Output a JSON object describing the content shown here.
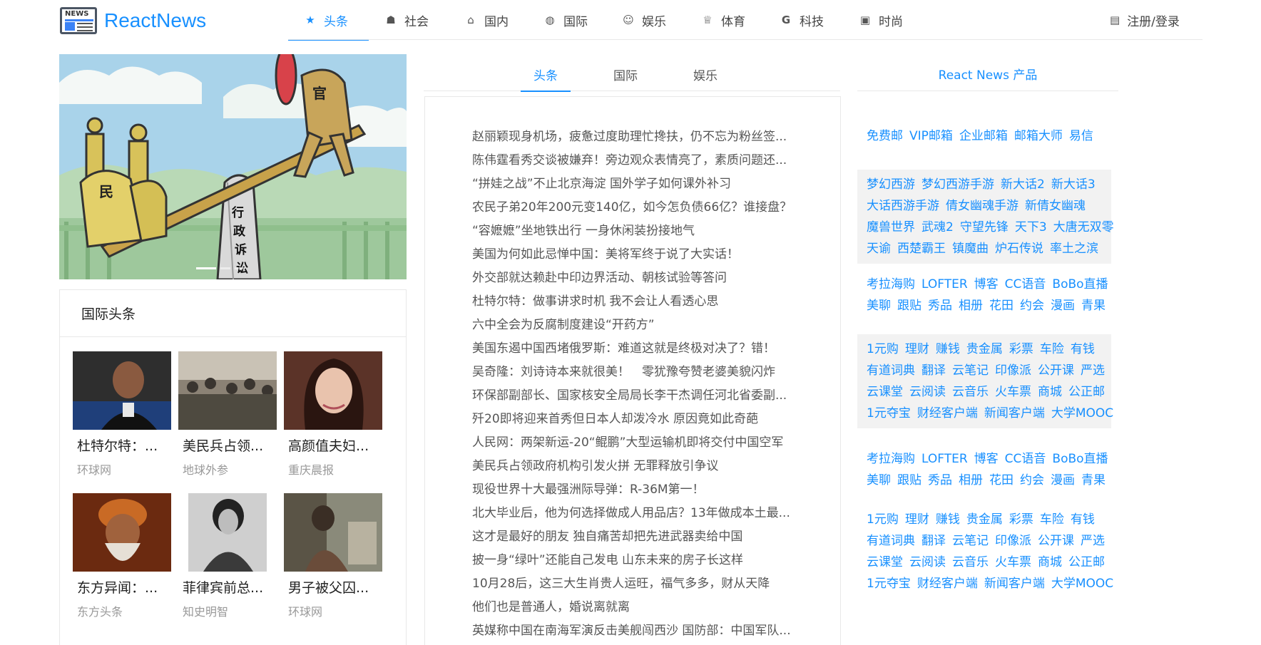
{
  "brand": {
    "logo_text": "NEWS",
    "title": "ReactNews"
  },
  "nav": {
    "items": [
      {
        "icon": "star-icon",
        "glyph": "★",
        "label": "头条",
        "active": true
      },
      {
        "icon": "user-icon",
        "glyph": "☗",
        "label": "社会"
      },
      {
        "icon": "lock-icon",
        "glyph": "⌂",
        "label": "国内"
      },
      {
        "icon": "globe-icon",
        "glyph": "◍",
        "label": "国际"
      },
      {
        "icon": "smile-icon",
        "glyph": "☺",
        "label": "娱乐"
      },
      {
        "icon": "trophy-icon",
        "glyph": "♕",
        "label": "体育"
      },
      {
        "icon": "google-icon",
        "glyph": "G",
        "label": "科技"
      },
      {
        "icon": "gift-icon",
        "glyph": "▣",
        "label": "时尚"
      }
    ],
    "account_icon": "idcard-icon",
    "account_glyph": "▤",
    "account_label": "注册/登录"
  },
  "carousel": {
    "slide_text_left": "民",
    "slide_text_right": "官",
    "slide_text_pillar": [
      "行",
      "政",
      "诉",
      "讼"
    ],
    "slide_count": 3,
    "active_slide": 1
  },
  "intl": {
    "heading": "国际头条",
    "items": [
      {
        "title": "杜特尔特：...",
        "source": "环球网"
      },
      {
        "title": "美民兵占领...",
        "source": "地球外参"
      },
      {
        "title": "高颜值夫妇...",
        "source": "重庆晨报"
      },
      {
        "title": "东方异闻：...",
        "source": "东方头条"
      },
      {
        "title": "菲律宾前总...",
        "source": "知史明智"
      },
      {
        "title": "男子被父囚...",
        "source": "环球网"
      }
    ]
  },
  "mid": {
    "tabs": [
      {
        "label": "头条",
        "active": true
      },
      {
        "label": "国际"
      },
      {
        "label": "娱乐"
      }
    ],
    "headlines": [
      "赵丽颖现身机场，疲惫过度助理忙搀扶，仍不忘为粉丝签...",
      "陈伟霆看秀交谈被嫌弃！旁边观众表情亮了，素质问题还...",
      "“拼娃之战”不止北京海淀 国外学子如何课外补习",
      "农民子弟20年200元变140亿，如今怎负债66亿？谁接盘？",
      "“容嬷嬷”坐地铁出行 一身休闲装扮接地气",
      "美国为何如此忌惮中国：美将军终于说了大实话！",
      "外交部就达赖赴中印边界活动、朝核试验等答问",
      "杜特尔特：做事讲求时机 我不会让人看透心思",
      "六中全会为反腐制度建设“开药方”",
      "美国东遏中国西堵俄罗斯：难道这就是终极对决了？错！",
      "吴奇隆：刘诗诗本来就很美！　零犹豫夸赞老婆美貌闪炸",
      "环保部副部长、国家核安全局局长李干杰调任河北省委副...",
      "歼20即将迎来首秀但日本人却泼冷水 原因竟如此奇葩",
      "人民网：两架新运-20“鲲鹏”大型运输机即将交付中国空军",
      "美民兵占领政府机构引发火拼 无罪释放引争议",
      "现役世界十大最强洲际导弹：R-36M第一！",
      "北大毕业后，他为何选择做成人用品店？13年做成本土最...",
      "这才是最好的朋友 独自痛苦却把先进武器卖给中国",
      "披一身“绿叶”还能自己发电 山东未来的房子长这样",
      "10月28后，这三大生肖贵人运旺，福气多多，财从天降",
      "他们也是普通人，婚说离就离",
      "英媒称中国在南海军演反击美舰闯西沙 国防部：中国军队..."
    ]
  },
  "products": {
    "heading": "React News 产品",
    "blocks": [
      {
        "shade": false,
        "lines": [
          [
            "免费邮",
            "VIP邮箱",
            "企业邮箱",
            "邮箱大师",
            "易信"
          ]
        ]
      },
      {
        "shade": true,
        "lines": [
          [
            "梦幻西游",
            "梦幻西游手游",
            "新大话2",
            "新大话3"
          ],
          [
            "大话西游手游",
            "倩女幽魂手游",
            "新倩女幽魂"
          ],
          [
            "魔兽世界",
            "武魂2",
            "守望先锋",
            "天下3",
            "大唐无双零"
          ],
          [
            "天谕",
            "西楚霸王",
            "镇魔曲",
            "炉石传说",
            "率土之滨"
          ]
        ]
      },
      {
        "shade": false,
        "lines": [
          [
            "考拉海购",
            "LOFTER",
            "博客",
            "CC语音",
            "BoBo直播"
          ],
          [
            "美聊",
            "跟贴",
            "秀品",
            "相册",
            "花田",
            "约会",
            "漫画",
            "青果"
          ]
        ]
      },
      {
        "shade": true,
        "lines": [
          [
            "1元购",
            "理财",
            "赚钱",
            "贵金属",
            "彩票",
            "车险",
            "有钱"
          ],
          [
            "有道词典",
            "翻译",
            "云笔记",
            "印像派",
            "公开课",
            "严选"
          ],
          [
            "云课堂",
            "云阅读",
            "云音乐",
            "火车票",
            "商城",
            "公正邮"
          ],
          [
            "1元夺宝",
            "财经客户端",
            "新闻客户端",
            "大学MOOC"
          ]
        ]
      },
      {
        "shade": false,
        "lines": [
          [
            "考拉海购",
            "LOFTER",
            "博客",
            "CC语音",
            "BoBo直播"
          ],
          [
            "美聊",
            "跟贴",
            "秀品",
            "相册",
            "花田",
            "约会",
            "漫画",
            "青果"
          ]
        ]
      },
      {
        "shade": false,
        "lines": [
          [
            "1元购",
            "理财",
            "赚钱",
            "贵金属",
            "彩票",
            "车险",
            "有钱"
          ],
          [
            "有道词典",
            "翻译",
            "云笔记",
            "印像派",
            "公开课",
            "严选"
          ],
          [
            "云课堂",
            "云阅读",
            "云音乐",
            "火车票",
            "商城",
            "公正邮"
          ],
          [
            "1元夺宝",
            "财经客户端",
            "新闻客户端",
            "大学MOOC"
          ]
        ]
      }
    ]
  }
}
